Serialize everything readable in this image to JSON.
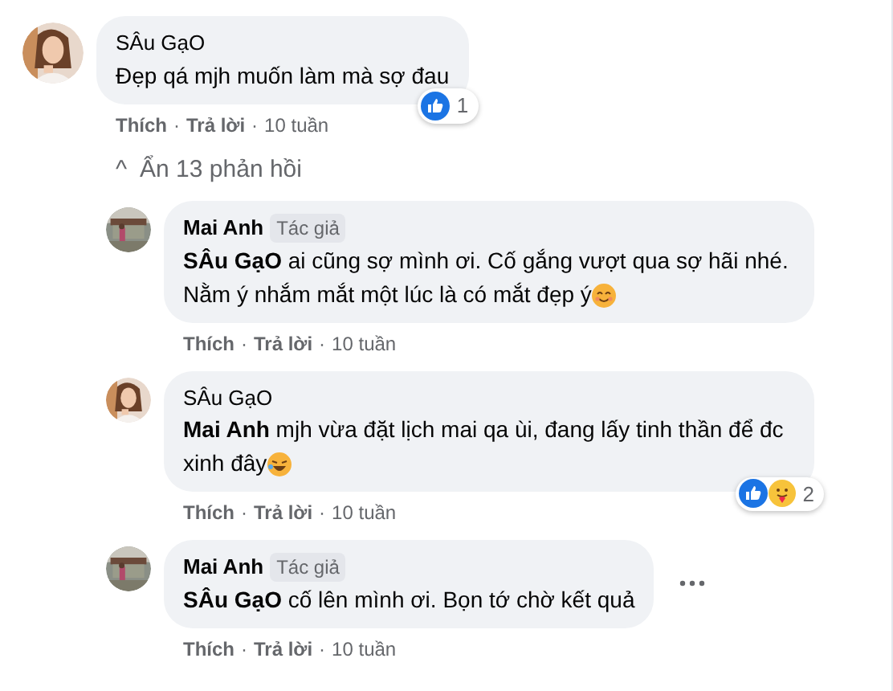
{
  "comment": {
    "name": "SÂu GạO",
    "text": "Đẹp qá mjh muốn làm mà sợ đau",
    "reactions": [
      {
        "kind": "like"
      }
    ],
    "reaction_count": "1",
    "actions": [
      "Thích",
      "Trả lời"
    ],
    "separator": "·",
    "time": "10 tuần",
    "more_menu": false
  },
  "replies_toggle": {
    "icon": "^",
    "label": "Ẩn 13 phản hồi"
  },
  "replies": [
    {
      "name": "Mai Anh",
      "badge": "Tác giả",
      "text": "**SÂu GạO** ai cũng sợ mình ơi. Cố gắng vượt qua sợ hãi nhé. Nằm ý nhắm mắt một lúc là có mắt đẹp ý",
      "emoji": {
        "kind": "smile"
      },
      "actions": [
        "Thích",
        "Trả lời"
      ],
      "separator": "·",
      "time": "10 tuần",
      "more_menu": false
    },
    {
      "name": "SÂu GạO",
      "text": "**Mai Anh** mjh vừa đặt lịch mai qa ùi, đang lấy tinh thần để đc xinh đây",
      "emoji": {
        "kind": "laugh"
      },
      "reactions": [
        {
          "kind": "like"
        },
        {
          "kind": "care"
        }
      ],
      "reaction_count": "2",
      "actions": [
        "Thích",
        "Trả lời"
      ],
      "separator": "·",
      "time": "10 tuần",
      "more_menu": false
    },
    {
      "name": "Mai Anh",
      "badge": "Tác giả",
      "text": "**SÂu GạO** cố lên mình ơi. Bọn tớ chờ kết quả",
      "actions": [
        "Thích",
        "Trả lời"
      ],
      "separator": "·",
      "time": "10 tuần",
      "more_menu": true
    }
  ]
}
